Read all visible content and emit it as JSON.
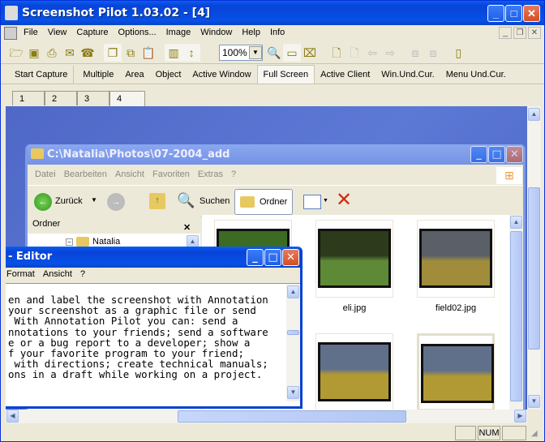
{
  "window": {
    "title": "Screenshot Pilot 1.03.02 - [4]",
    "controls": {
      "minimize": "_",
      "maximize": "□",
      "close": "✕"
    }
  },
  "menubar": {
    "items": [
      "File",
      "View",
      "Capture",
      "Options...",
      "Image",
      "Window",
      "Help",
      "Info"
    ],
    "mdi_controls": {
      "minimize": "_",
      "restore": "❐",
      "close": "✕"
    }
  },
  "toolbar": {
    "zoom_value": "100%",
    "icons": [
      "open-icon",
      "save-icon",
      "print-icon",
      "email-icon",
      "fax-icon",
      "copy-page-icon",
      "copy-region-icon",
      "paste-icon",
      "grid-icon",
      "resize-icon",
      "zoom-icon",
      "fit-window-icon",
      "crop-icon",
      "new-annotation-icon",
      "delete-annotation-icon",
      "undo-icon",
      "redo-icon",
      "send-back-icon",
      "bring-front-icon",
      "page-icon"
    ]
  },
  "capture_bar": {
    "start": "Start Capture",
    "modes": [
      "Multiple",
      "Area",
      "Object",
      "Active Window",
      "Full Screen",
      "Active Client",
      "Win.Und.Cur.",
      "Menu Und.Cur."
    ],
    "active_mode": "Full Screen"
  },
  "doc_tabs": {
    "items": [
      "1",
      "2",
      "3",
      "4"
    ],
    "active": "4"
  },
  "explorer": {
    "title": "C:\\Natalia\\Photos\\07-2004_add",
    "menu": [
      "Datei",
      "Bearbeiten",
      "Ansicht",
      "Favoriten",
      "Extras",
      "?"
    ],
    "back_label": "Zurück",
    "search_label": "Suchen",
    "folders_label": "Ordner",
    "folder_pane_title": "Ordner",
    "folder_pane_close": "✕",
    "tree_item": "Natalia",
    "thumbnails": [
      {
        "name": "",
        "colors": [
          "#3c6b22",
          "#7fae45"
        ]
      },
      {
        "name": "eli.jpg",
        "colors": [
          "#2d3a1c",
          "#5e8a37"
        ]
      },
      {
        "name": "field02.jpg",
        "colors": [
          "#5b6068",
          "#a08c3b"
        ]
      },
      {
        "name": "",
        "colors": [
          "#61708a",
          "#b19a33"
        ]
      },
      {
        "name": "",
        "colors": [
          "#61708a",
          "#b19a33"
        ]
      }
    ]
  },
  "editor": {
    "title": "- Editor",
    "menu": [
      "Format",
      "Ansicht",
      "?"
    ],
    "text_lines": [
      "en and label the screenshot with Annotation",
      "your screenshot as a graphic file or send",
      " With Annotation Pilot you can: send a",
      "nnotations to your friends; send a software",
      "e or a bug report to a developer; show a",
      "f your favorite program to your friend;",
      " with directions; create technical manuals;",
      "ons in a draft while working on a project."
    ]
  },
  "statusbar": {
    "panels": [
      "",
      "NUM",
      ""
    ]
  }
}
